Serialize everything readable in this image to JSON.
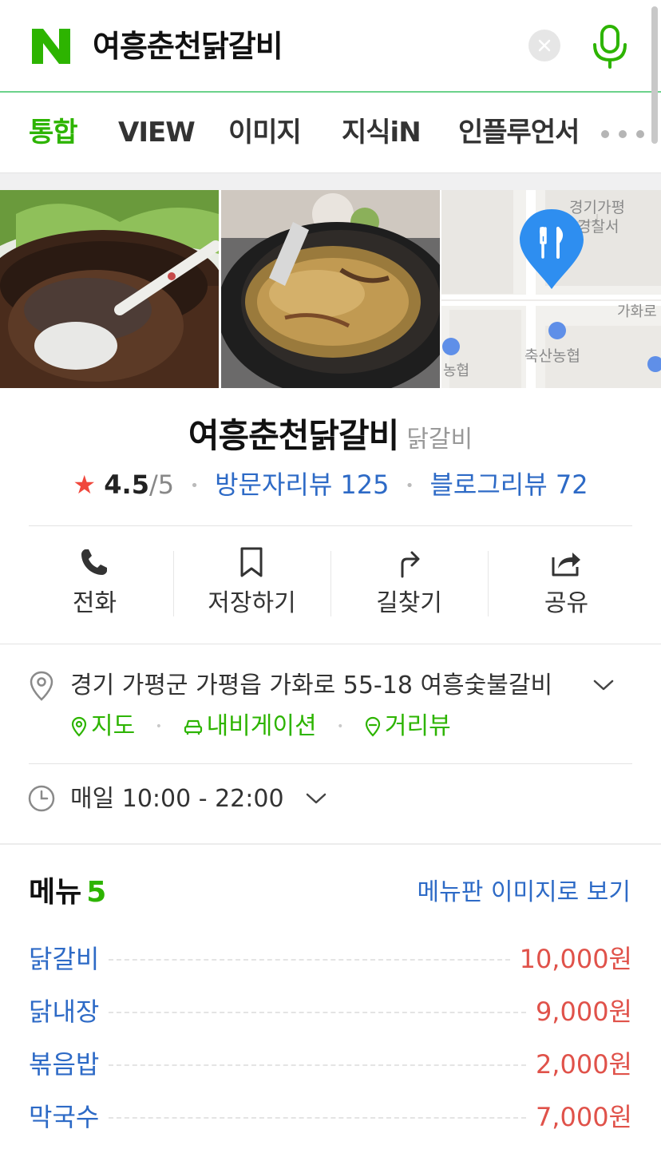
{
  "search": {
    "logo_letter": "N",
    "query": "여흥춘천닭갈비",
    "accent_color": "#2db400"
  },
  "tabs": [
    {
      "label": "통합",
      "active": true
    },
    {
      "label": "VIEW",
      "active": false
    },
    {
      "label": "이미지",
      "active": false
    },
    {
      "label": "지식iN",
      "active": false
    },
    {
      "label": "인플루언서",
      "active": false
    }
  ],
  "map_thumb": {
    "labels": [
      "경기가평",
      "경찰서",
      "가화로",
      "축산농협",
      "농협"
    ]
  },
  "place": {
    "name": "여흥춘천닭갈비",
    "category": "닭갈비",
    "rating": "4.5",
    "rating_max": "/5",
    "visitor_reviews": "방문자리뷰 125",
    "blog_reviews": "블로그리뷰 72"
  },
  "actions": [
    {
      "label": "전화",
      "icon": "phone-icon"
    },
    {
      "label": "저장하기",
      "icon": "bookmark-icon"
    },
    {
      "label": "길찾기",
      "icon": "directions-icon"
    },
    {
      "label": "공유",
      "icon": "share-icon"
    }
  ],
  "info": {
    "address": "경기 가평군 가평읍 가화로 55-18 여흥숯불갈비",
    "links": [
      "지도",
      "내비게이션",
      "거리뷰"
    ],
    "hours": "매일 10:00 - 22:00"
  },
  "menu": {
    "title": "메뉴",
    "count": "5",
    "view_image_link": "메뉴판 이미지로 보기",
    "items": [
      {
        "name": "닭갈비",
        "price": "10,000원"
      },
      {
        "name": "닭내장",
        "price": "9,000원"
      },
      {
        "name": "볶음밥",
        "price": "2,000원"
      },
      {
        "name": "막국수",
        "price": "7,000원"
      }
    ]
  }
}
